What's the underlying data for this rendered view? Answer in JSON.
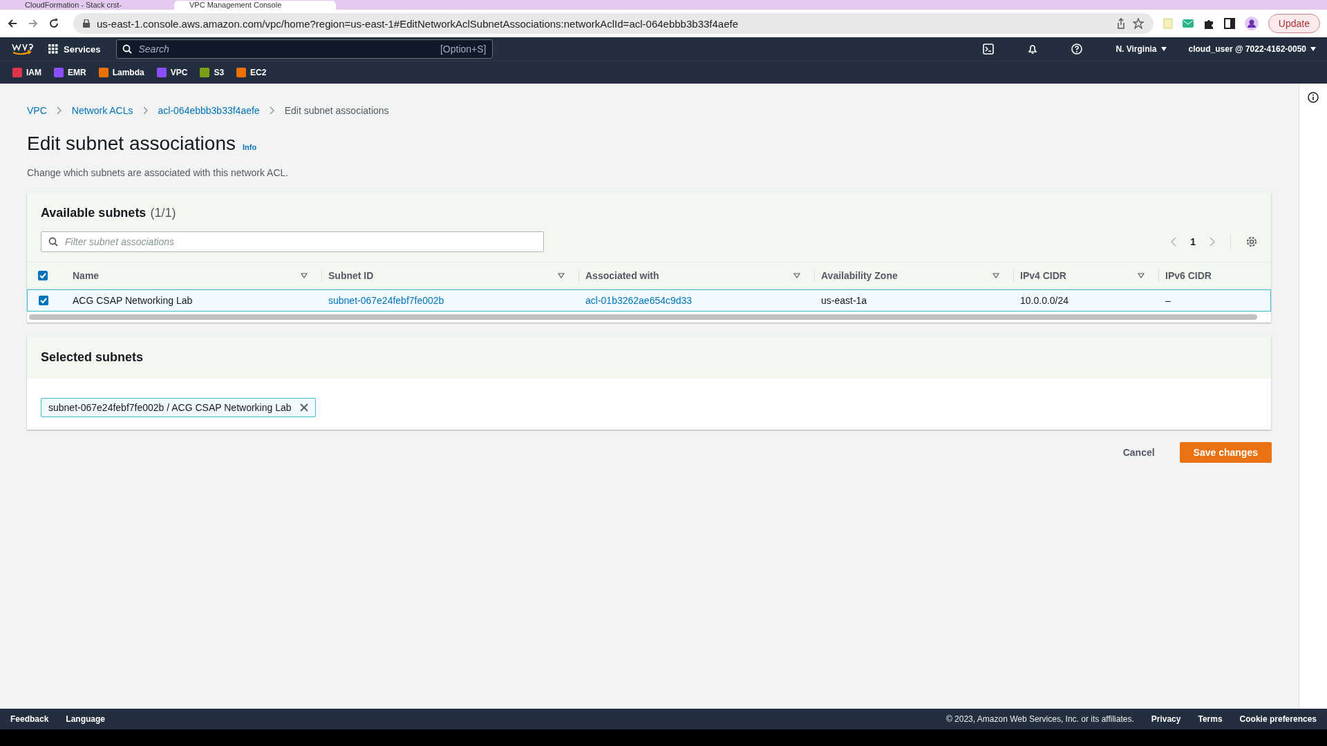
{
  "browser": {
    "tabs": [
      {
        "title": "CloudFormation - Stack crst-",
        "selected": false
      },
      {
        "title": "VPC Management Console",
        "selected": true
      }
    ],
    "url": "us-east-1.console.aws.amazon.com/vpc/home?region=us-east-1#EditNetworkAclSubnetAssociations:networkAclId=acl-064ebbb3b33f4aefe",
    "update_button": "Update"
  },
  "console_nav": {
    "services": "Services",
    "search": {
      "placeholder": "Search",
      "shortcut": "[Option+S]"
    },
    "region": "N. Virginia",
    "account": "cloud_user @ 7022-4162-0050",
    "favorites": [
      {
        "label": "IAM",
        "color": "#dd344c"
      },
      {
        "label": "EMR",
        "color": "#8c4fff"
      },
      {
        "label": "Lambda",
        "color": "#ed7100"
      },
      {
        "label": "VPC",
        "color": "#8c4fff"
      },
      {
        "label": "S3",
        "color": "#7aa116"
      },
      {
        "label": "EC2",
        "color": "#ed7100"
      }
    ]
  },
  "breadcrumbs": [
    {
      "label": "VPC",
      "kind": "link"
    },
    {
      "label": "Network ACLs",
      "kind": "link"
    },
    {
      "label": "acl-064ebbb3b33f4aefe",
      "kind": "link"
    },
    {
      "label": "Edit subnet associations",
      "kind": "current"
    }
  ],
  "page": {
    "title": "Edit subnet associations",
    "info": "Info",
    "description": "Change which subnets are associated with this network ACL."
  },
  "available_subnets": {
    "title": "Available subnets",
    "count": "(1/1)",
    "filter": {
      "placeholder": "Filter subnet associations"
    },
    "page": "1",
    "all_selected": true,
    "columns": [
      {
        "label": "Name",
        "sortable": true
      },
      {
        "label": "Subnet ID",
        "sortable": true
      },
      {
        "label": "Associated with",
        "sortable": true
      },
      {
        "label": "Availability Zone",
        "sortable": true
      },
      {
        "label": "IPv4 CIDR",
        "sortable": true
      },
      {
        "label": "IPv6 CIDR",
        "sortable": false
      }
    ],
    "rows": [
      {
        "selected": true,
        "cells": [
          {
            "text": "ACG CSAP Networking Lab",
            "kind": "text"
          },
          {
            "text": "subnet-067e24febf7fe002b",
            "kind": "link"
          },
          {
            "text": "acl-01b3262ae654c9d33",
            "kind": "link"
          },
          {
            "text": "us-east-1a",
            "kind": "text"
          },
          {
            "text": "10.0.0.0/24",
            "kind": "text"
          },
          {
            "text": "–",
            "kind": "text"
          }
        ]
      }
    ]
  },
  "selected_subnets": {
    "title": "Selected subnets",
    "tokens": [
      "subnet-067e24febf7fe002b / ACG CSAP Networking Lab"
    ]
  },
  "actions": {
    "cancel": "Cancel",
    "save": "Save changes"
  },
  "footer": {
    "left": [
      "Feedback",
      "Language"
    ],
    "copyright": "© 2023, Amazon Web Services, Inc. or its affiliates.",
    "links": [
      "Privacy",
      "Terms",
      "Cookie preferences"
    ]
  }
}
